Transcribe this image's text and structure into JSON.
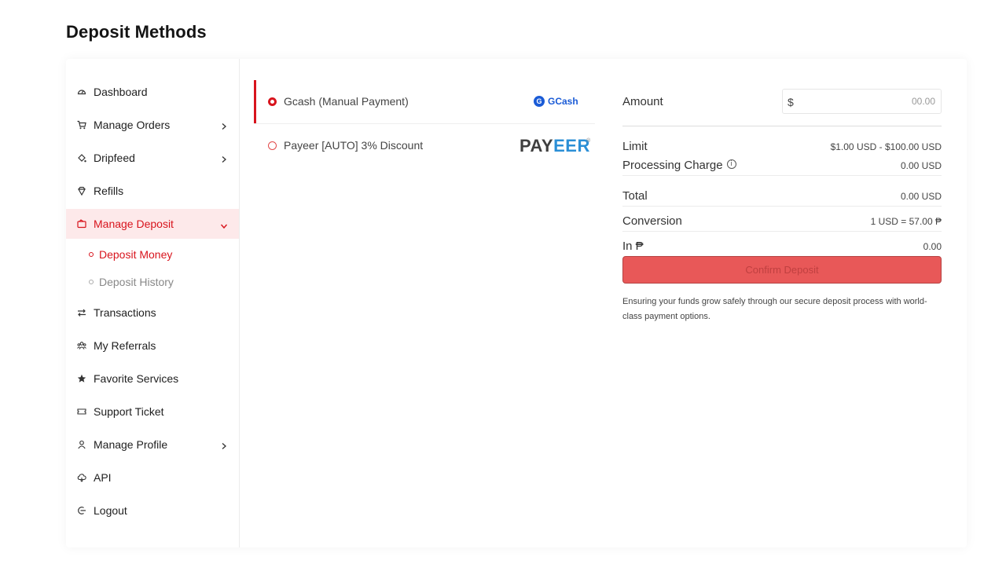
{
  "page": {
    "title": "Deposit Methods"
  },
  "sidebar": {
    "items": [
      {
        "label": "Dashboard",
        "icon": "dashboard-icon"
      },
      {
        "label": "Manage Orders",
        "icon": "cart-icon",
        "expandable": true
      },
      {
        "label": "Dripfeed",
        "icon": "dripfeed-icon",
        "expandable": true
      },
      {
        "label": "Refills",
        "icon": "refills-icon"
      },
      {
        "label": "Manage Deposit",
        "icon": "wallet-icon",
        "expandable": true,
        "expanded": true,
        "active": true
      },
      {
        "label": "Transactions",
        "icon": "transfer-icon"
      },
      {
        "label": "My Referrals",
        "icon": "referrals-icon"
      },
      {
        "label": "Favorite Services",
        "icon": "star-icon"
      },
      {
        "label": "Support Ticket",
        "icon": "ticket-icon"
      },
      {
        "label": "Manage Profile",
        "icon": "user-icon",
        "expandable": true
      },
      {
        "label": "API",
        "icon": "cloud-icon"
      },
      {
        "label": "Logout",
        "icon": "logout-icon"
      }
    ],
    "subitems": [
      {
        "label": "Deposit Money",
        "active": true
      },
      {
        "label": "Deposit History",
        "active": false
      }
    ]
  },
  "methods": [
    {
      "label": "Gcash (Manual Payment)",
      "selected": true,
      "logo_text": "GCash",
      "logo_mark": "G"
    },
    {
      "label": "Payeer [AUTO] 3% Discount",
      "selected": false,
      "logo_text_a": "PAY",
      "logo_text_b": "EER",
      "logo_reg": "®"
    }
  ],
  "summary": {
    "amount_label": "Amount",
    "amount_currency": "$",
    "amount_placeholder": "00.00",
    "limit_label": "Limit",
    "limit_value": "$1.00 USD - $100.00 USD",
    "processing_label": "Processing Charge",
    "processing_value": "0.00 USD",
    "total_label": "Total",
    "total_value": "0.00 USD",
    "conversion_label": "Conversion",
    "conversion_value": "1 USD = 57.00 ₱",
    "in_label": "In ₱",
    "in_value": "0.00",
    "confirm_label": "Confirm Deposit",
    "note": "Ensuring your funds grow safely through our secure deposit process with world-class payment options."
  },
  "colors": {
    "accent": "#d8141d",
    "active_bg": "#fde9ea",
    "button_bg": "#e85858",
    "gcash_blue": "#1a5bd6",
    "payeer_blue": "#2b8fd6"
  }
}
